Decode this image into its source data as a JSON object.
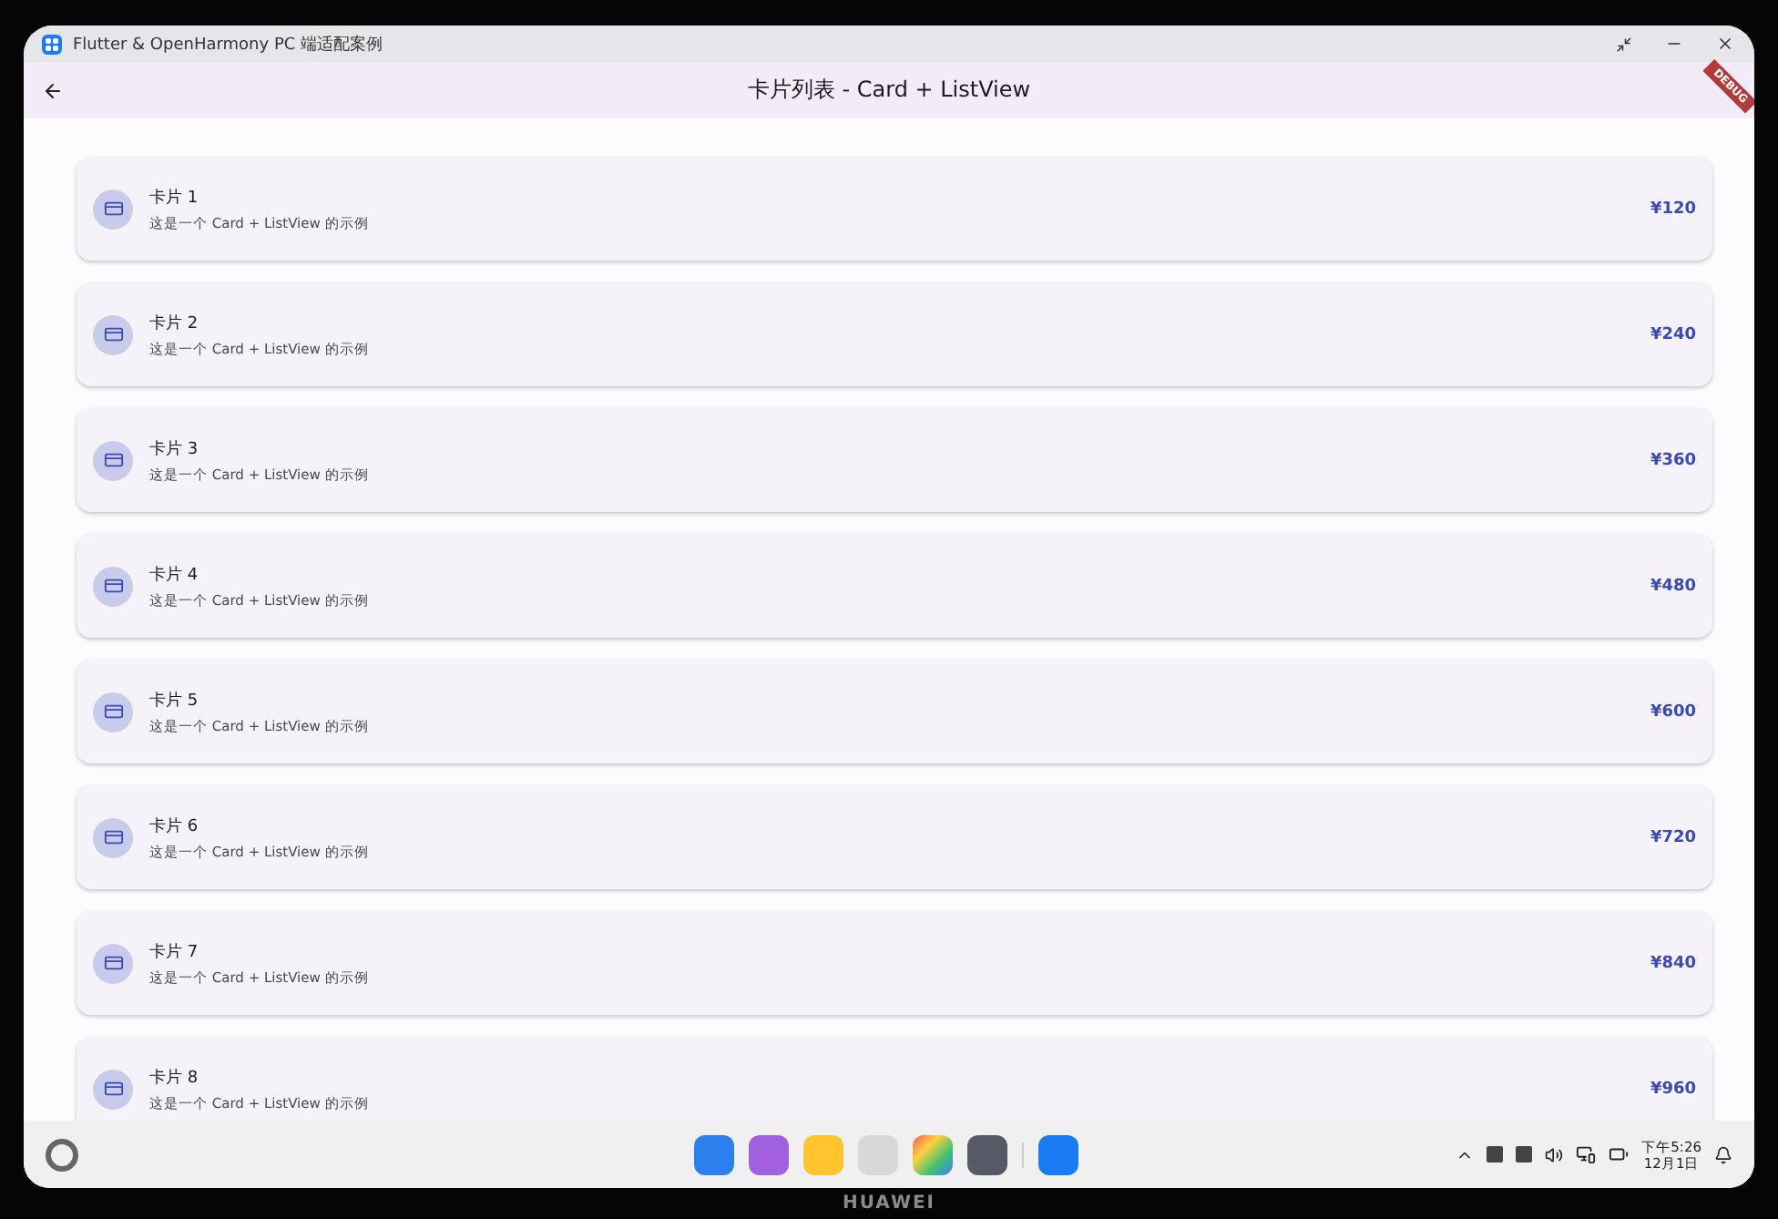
{
  "window": {
    "title": "Flutter & OpenHarmony PC 端适配案例"
  },
  "app_bar": {
    "title": "卡片列表 - Card + ListView",
    "banner": "DEBUG"
  },
  "cards": [
    {
      "title": "卡片 1",
      "subtitle": "这是一个 Card + ListView 的示例",
      "price": "¥120"
    },
    {
      "title": "卡片 2",
      "subtitle": "这是一个 Card + ListView 的示例",
      "price": "¥240"
    },
    {
      "title": "卡片 3",
      "subtitle": "这是一个 Card + ListView 的示例",
      "price": "¥360"
    },
    {
      "title": "卡片 4",
      "subtitle": "这是一个 Card + ListView 的示例",
      "price": "¥480"
    },
    {
      "title": "卡片 5",
      "subtitle": "这是一个 Card + ListView 的示例",
      "price": "¥600"
    },
    {
      "title": "卡片 6",
      "subtitle": "这是一个 Card + ListView 的示例",
      "price": "¥720"
    },
    {
      "title": "卡片 7",
      "subtitle": "这是一个 Card + ListView 的示例",
      "price": "¥840"
    },
    {
      "title": "卡片 8",
      "subtitle": "这是一个 Card + ListView 的示例",
      "price": "¥960"
    }
  ],
  "taskbar": {
    "time": "下午5:26",
    "date": "12月1日"
  },
  "device": {
    "brand": "HUAWEI"
  }
}
